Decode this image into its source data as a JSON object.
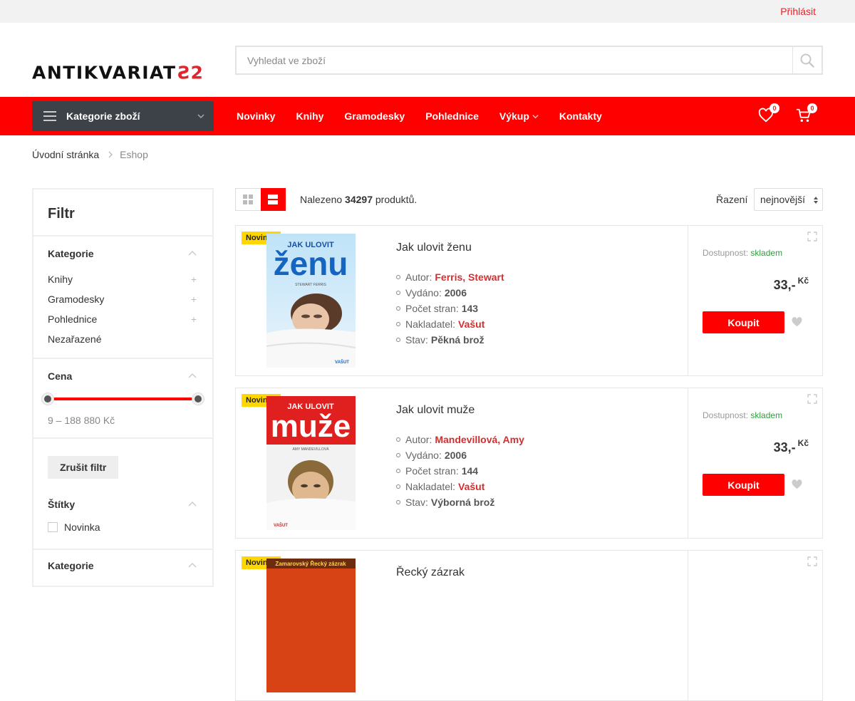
{
  "topbar": {
    "login": "Přihlásit"
  },
  "header": {
    "logo_text": "ANTIKVARIAT",
    "logo_mark": "Ƨ2",
    "search_placeholder": "Vyhledat ve zboží"
  },
  "nav": {
    "categories_label": "Kategorie zboží",
    "items": [
      {
        "label": "Novinky"
      },
      {
        "label": "Knihy"
      },
      {
        "label": "Gramodesky"
      },
      {
        "label": "Pohlednice"
      },
      {
        "label": "Výkup"
      },
      {
        "label": "Kontakty"
      }
    ],
    "wishlist_count": "0",
    "cart_count": "0"
  },
  "breadcrumb": {
    "home": "Úvodní stránka",
    "current": "Eshop"
  },
  "sidebar": {
    "title": "Filtr",
    "categories": {
      "heading": "Kategorie",
      "items": [
        "Knihy",
        "Gramodesky",
        "Pohlednice",
        "Nezařazené"
      ],
      "expand_symbol": "+"
    },
    "price": {
      "heading": "Cena",
      "range": "9 – 188 880 Kč"
    },
    "reset_label": "Zrušit filtr",
    "tags": {
      "heading": "Štítky",
      "option": "Novinka"
    },
    "categories2_heading": "Kategorie"
  },
  "toolbar": {
    "found_prefix": "Nalezeno",
    "found_count": "34297",
    "found_suffix": "produktů.",
    "sort_label": "Řazení",
    "sort_value": "nejnovější"
  },
  "products": [
    {
      "badge": "Novinka",
      "title": "Jak ulovit ženu",
      "cover_top": "JAK ULOVIT",
      "cover_big": "ženu",
      "cover_author": "STEWART FERRIS",
      "cover_publisher": "VAŠUT",
      "details": [
        {
          "label": "Autor:",
          "value": "Ferris, Stewart",
          "link": true
        },
        {
          "label": "Vydáno:",
          "value": "2006",
          "link": false
        },
        {
          "label": "Počet stran:",
          "value": "143",
          "link": false
        },
        {
          "label": "Nakladatel:",
          "value": "Vašut",
          "link": true
        },
        {
          "label": "Stav:",
          "value": "Pěkná brož",
          "link": false
        }
      ],
      "availability_label": "Dostupnost:",
      "availability_value": "skladem",
      "price": "33,-",
      "currency": "Kč",
      "buy_label": "Koupit"
    },
    {
      "badge": "Novinka",
      "title": "Jak ulovit muže",
      "cover_top": "JAK ULOVIT",
      "cover_big": "muže",
      "cover_author": "AMY MANDEVILLOVÁ",
      "cover_publisher": "VAŠUT",
      "details": [
        {
          "label": "Autor:",
          "value": "Mandevillová, Amy",
          "link": true
        },
        {
          "label": "Vydáno:",
          "value": "2006",
          "link": false
        },
        {
          "label": "Počet stran:",
          "value": "144",
          "link": false
        },
        {
          "label": "Nakladatel:",
          "value": "Vašut",
          "link": true
        },
        {
          "label": "Stav:",
          "value": "Výborná brož",
          "link": false
        }
      ],
      "availability_label": "Dostupnost:",
      "availability_value": "skladem",
      "price": "33,-",
      "currency": "Kč",
      "buy_label": "Koupit"
    },
    {
      "badge": "Novinka",
      "title": "Řecký zázrak",
      "cover_top": "Zamarovský   Řecký zázrak"
    }
  ],
  "colors": {
    "accent": "#ff0000",
    "link": "#d32f2f",
    "badge": "#ffd700",
    "nav_dark": "#3d4248",
    "in_stock": "#2e9e3e"
  }
}
